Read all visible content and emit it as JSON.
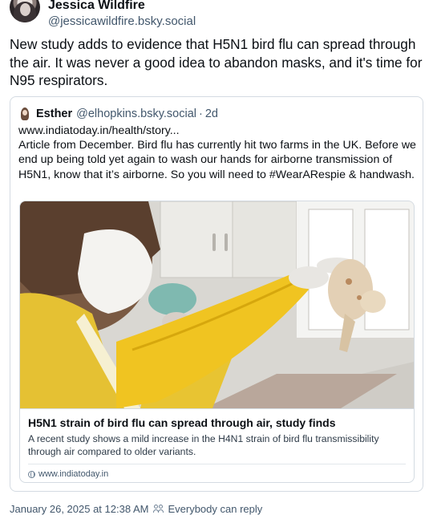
{
  "post": {
    "author_name": "Jessica Wildfire",
    "author_handle": "@jessicawildfire.bsky.social",
    "text": "New study adds to evidence that H5N1 bird flu can spread through the air. It was never a good idea to abandon masks, and it's time for N95 respirators.",
    "timestamp": "January 26, 2025 at 12:38 AM",
    "reply_setting": "Everybody can reply"
  },
  "quote": {
    "author_name": "Esther",
    "author_handle": "@elhopkins.bsky.social",
    "separator": "·",
    "age": "2d",
    "text": "www.indiatoday.in/health/story...\nArticle from December. Bird flu has currently hit two farms in the UK. Before we end up being told yet again to wash our hands for airborne transmission of H5N1, know that it’s airborne. So you will need to #WearARespie & handwash."
  },
  "link_card": {
    "title": "H5N1 strain of bird flu can spread through air, study finds",
    "description": "A recent study shows a mild increase in the H4N1 strain of bird flu transmissibility through air compared to older variants.",
    "domain": "www.indiatoday.in",
    "image_description_icon": "photo-lab-worker-with-chicken"
  },
  "colors": {
    "text_primary": "#0b0f14",
    "text_muted": "#42576c",
    "border": "#d4dbe2"
  }
}
